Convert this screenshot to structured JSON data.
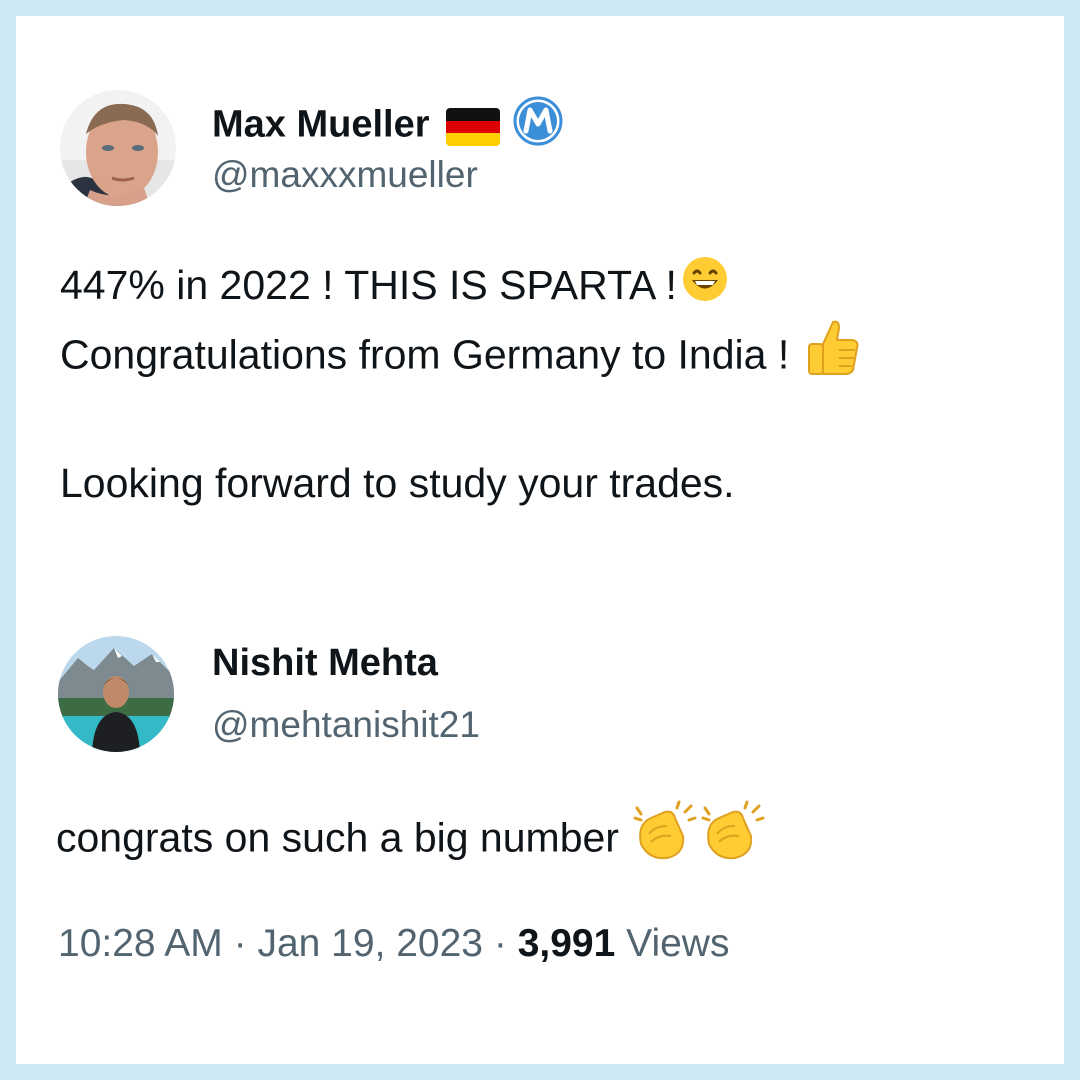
{
  "tweets": [
    {
      "name": "Max Mueller",
      "handle": "@maxxxmueller",
      "badges": [
        "germany-flag-icon",
        "m-badge-icon"
      ],
      "lines": [
        "447% in 2022 ! THIS IS SPARTA !",
        "Congratulations from Germany to India !",
        "Looking forward to study your trades."
      ]
    },
    {
      "name": "Nishit Mehta",
      "handle": "@mehtanishit21",
      "lines": [
        "congrats on such a big number"
      ]
    }
  ],
  "meta": {
    "time": "10:28 AM",
    "separator": "·",
    "date": "Jan 19, 2023",
    "views_count": "3,991",
    "views_label": "Views"
  },
  "colors": {
    "background": "#cfe8f5",
    "card": "#ffffff",
    "text": "#0f1419",
    "secondary": "#536471",
    "badge_blue": "#3b8fd9"
  }
}
